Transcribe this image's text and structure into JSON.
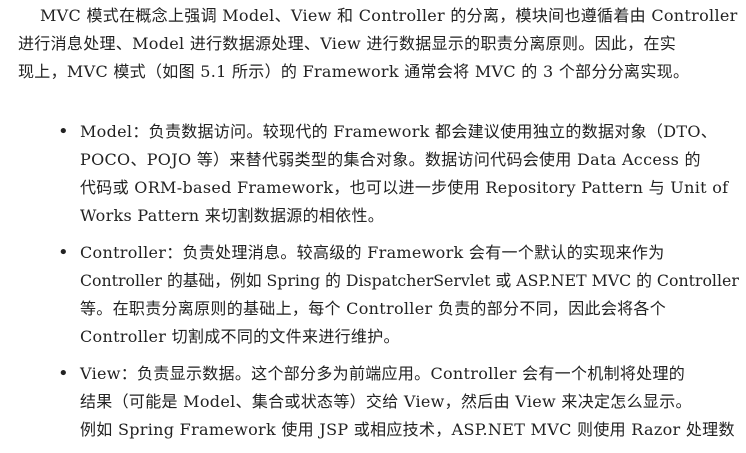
{
  "intro": {
    "lines": [
      "MVC 模式在概念上强调 Model、View 和 Controller 的分离，模块间也遵循着由 Controller",
      "进行消息处理、Model 进行数据源处理、View 进行数据显示的职责分离原则。因此，在实",
      "现上，MVC 模式（如图 5.1 所示）的 Framework 通常会将 MVC 的 3 个部分分离实现。"
    ]
  },
  "list": {
    "bullet_symbol": "•",
    "items": [
      {
        "lines": [
          "Model：负责数据访问。较现代的 Framework 都会建议使用独立的数据对象（DTO、",
          "POCO、POJO 等）来替代弱类型的集合对象。数据访问代码会使用 Data Access 的",
          "代码或 ORM-based Framework，也可以进一步使用 Repository Pattern 与 Unit of",
          "Works Pattern 来切割数据源的相依性。"
        ]
      },
      {
        "lines": [
          "Controller：负责处理消息。较高级的 Framework 会有一个默认的实现来作为",
          "Controller 的基础，例如 Spring 的 DispatcherServlet 或 ASP.NET MVC 的 Controller",
          "等。在职责分离原则的基础上，每个 Controller 负责的部分不同，因此会将各个",
          "Controller 切割成不同的文件来进行维护。"
        ]
      },
      {
        "lines": [
          "View：负责显示数据。这个部分多为前端应用。Controller 会有一个机制将处理的",
          "结果（可能是 Model、集合或状态等）交给 View，然后由 View 来决定怎么显示。",
          "例如 Spring Framework 使用 JSP 或相应技术，ASP.NET MVC 则使用 Razor 处理数"
        ]
      }
    ]
  }
}
